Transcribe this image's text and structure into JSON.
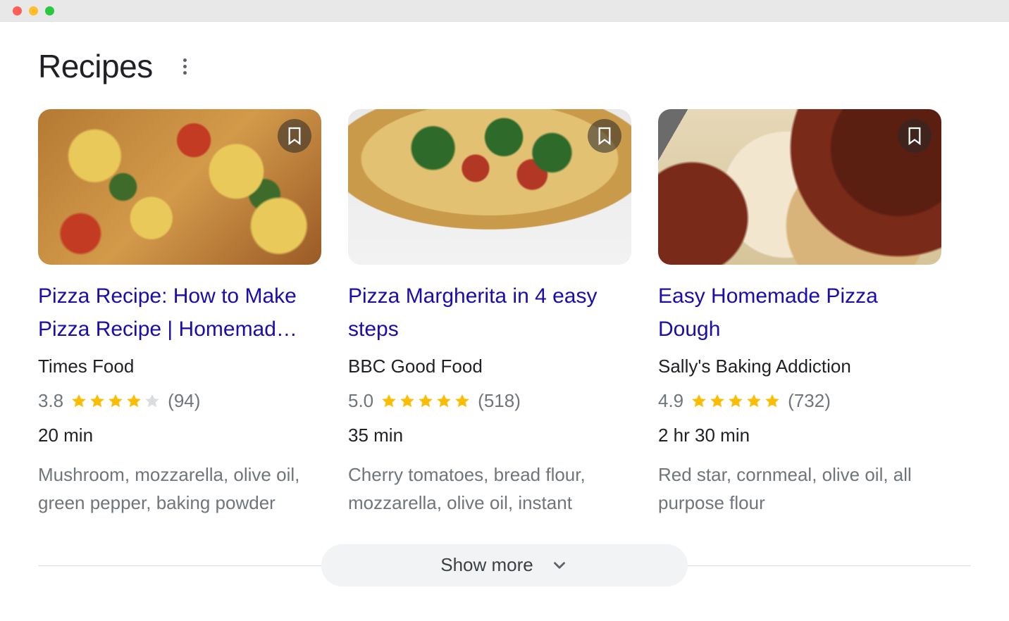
{
  "header": {
    "title": "Recipes"
  },
  "cards": [
    {
      "title": "Pizza Recipe: How to Make Pizza Recipe | Homemad…",
      "source": "Times Food",
      "rating_value": "3.8",
      "rating_stars": 4,
      "rating_count": "(94)",
      "time": "20 min",
      "ingredients": "Mushroom, mozzarella, olive oil, green pepper, baking powder"
    },
    {
      "title": "Pizza Margherita in 4 easy steps",
      "source": "BBC Good Food",
      "rating_value": "5.0",
      "rating_stars": 5,
      "rating_count": "(518)",
      "time": "35 min",
      "ingredients": "Cherry tomatoes, bread flour, mozzarella, olive oil, instant"
    },
    {
      "title": "Easy Homemade Pizza Dough",
      "source": "Sally's Baking Addiction",
      "rating_value": "4.9",
      "rating_stars": 5,
      "rating_count": "(732)",
      "time": "2 hr 30 min",
      "ingredients": "Red star, cornmeal, olive oil, all purpose flour"
    }
  ],
  "show_more_label": "Show more"
}
